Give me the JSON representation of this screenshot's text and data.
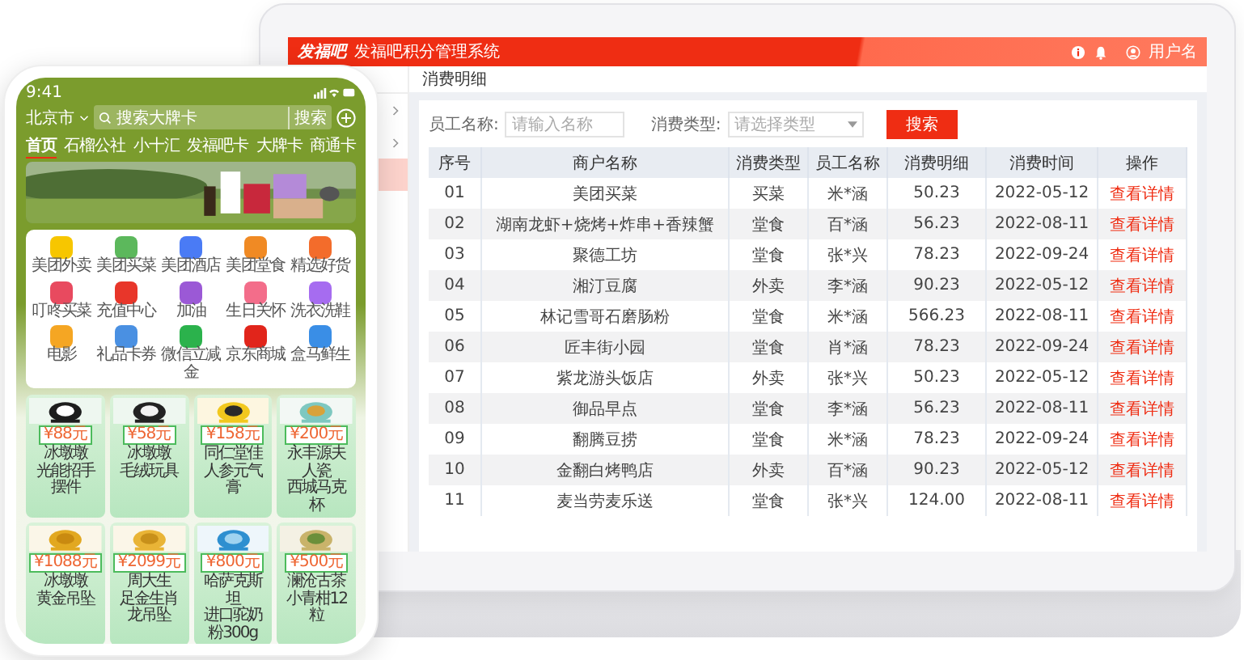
{
  "laptop": {
    "header": {
      "logo": "发福吧",
      "title": "发福吧积分管理系统",
      "user": "用户名"
    },
    "sidebar": {
      "items": [
        {
          "kind": "group",
          "selected": false
        },
        {
          "kind": "group",
          "selected": false
        },
        {
          "kind": "link",
          "selected": true
        }
      ]
    },
    "breadcrumb": "消费明细",
    "filters": [
      {
        "kind": "input",
        "label": "员工名称:",
        "placeholder": "请输入名称"
      },
      {
        "kind": "select",
        "label": "消费类型:",
        "placeholder": "请选择类型"
      }
    ],
    "search_button": "搜索",
    "table": {
      "columns": [
        {
          "label": "序号",
          "kind": "text"
        },
        {
          "label": "商户名称",
          "kind": "text"
        },
        {
          "label": "消费类型",
          "kind": "text"
        },
        {
          "label": "员工名称",
          "kind": "text"
        },
        {
          "label": "消费明细",
          "kind": "text"
        },
        {
          "label": "消费时间",
          "kind": "text"
        },
        {
          "label": "操作",
          "kind": "link"
        }
      ],
      "rows": [
        [
          "01",
          "美团买菜",
          "买菜",
          "米*涵",
          "50.23",
          "2022-05-12",
          "查看详情"
        ],
        [
          "02",
          "湖南龙虾+烧烤+炸串+香辣蟹",
          "堂食",
          "百*涵",
          "56.23",
          "2022-08-11",
          "查看详情"
        ],
        [
          "03",
          "聚德工坊",
          "堂食",
          "张*兴",
          "78.23",
          "2022-09-24",
          "查看详情"
        ],
        [
          "04",
          "湘汀豆腐",
          "外卖",
          "李*涵",
          "90.23",
          "2022-05-12",
          "查看详情"
        ],
        [
          "05",
          "林记雪哥石磨肠粉",
          "堂食",
          "米*涵",
          "566.23",
          "2022-08-11",
          "查看详情"
        ],
        [
          "06",
          "匠丰街小园",
          "堂食",
          "肖*涵",
          "78.23",
          "2022-09-24",
          "查看详情"
        ],
        [
          "07",
          "紫龙游头饭店",
          "外卖",
          "张*兴",
          "50.23",
          "2022-05-12",
          "查看详情"
        ],
        [
          "08",
          "御品早点",
          "堂食",
          "李*涵",
          "56.23",
          "2022-08-11",
          "查看详情"
        ],
        [
          "09",
          "翻腾豆捞",
          "堂食",
          "米*涵",
          "78.23",
          "2022-09-24",
          "查看详情"
        ],
        [
          "10",
          "金翻白烤鸭店",
          "外卖",
          "百*涵",
          "90.23",
          "2022-05-12",
          "查看详情"
        ],
        [
          "11",
          "麦当劳麦乐送",
          "堂食",
          "张*兴",
          "124.00",
          "2022-08-11",
          "查看详情"
        ]
      ]
    }
  },
  "phone": {
    "status_time": "9:41",
    "location": "北京市",
    "search_placeholder": "搜索大牌卡",
    "search_button": "搜索",
    "tabs": [
      {
        "label": "首页",
        "selected": true
      },
      {
        "label": "石榴公社",
        "selected": false
      },
      {
        "label": "小十汇",
        "selected": false
      },
      {
        "label": "发福吧卡",
        "selected": false
      },
      {
        "label": "大牌卡",
        "selected": false
      },
      {
        "label": "商通卡",
        "selected": false
      }
    ],
    "services": [
      {
        "label": "美团外卖",
        "color": "#f7c600"
      },
      {
        "label": "美团买菜",
        "color": "#5cb85c"
      },
      {
        "label": "美团酒店",
        "color": "#4a7bf5"
      },
      {
        "label": "美团堂食",
        "color": "#f08a24"
      },
      {
        "label": "精选好货",
        "color": "#f36c2b"
      },
      {
        "label": "叮咚买菜",
        "color": "#e84a5f"
      },
      {
        "label": "充值中心",
        "color": "#e8362a"
      },
      {
        "label": "加油",
        "color": "#9b59d6"
      },
      {
        "label": "生日关怀",
        "color": "#f36d8a"
      },
      {
        "label": "洗衣洗鞋",
        "color": "#a66cf0"
      },
      {
        "label": "电影",
        "color": "#f5a623"
      },
      {
        "label": "礼品卡券",
        "color": "#4a90e2"
      },
      {
        "label": "微信立减金",
        "color": "#2bb24c"
      },
      {
        "label": "京东商城",
        "color": "#e1251b"
      },
      {
        "label": "盒马鲜生",
        "color": "#3a8ee6"
      }
    ],
    "products": [
      {
        "price": "¥88元",
        "lines": [
          "冰墩墩",
          "光能招手摆件"
        ]
      },
      {
        "price": "¥58元",
        "lines": [
          "冰墩墩",
          "毛绒玩具"
        ]
      },
      {
        "price": "¥158元",
        "lines": [
          "同仁堂佳",
          "人参元气膏"
        ]
      },
      {
        "price": "¥200元",
        "lines": [
          "永丰源夫人瓷",
          "西城马克杯"
        ]
      },
      {
        "price": "¥1088元",
        "lines": [
          "冰墩墩",
          "黄金吊坠"
        ]
      },
      {
        "price": "¥2099元",
        "lines": [
          "周大生",
          "足金生肖龙吊坠"
        ]
      },
      {
        "price": "¥800元",
        "lines": [
          "哈萨克斯坦",
          "进口驼奶粉300g"
        ]
      },
      {
        "price": "¥500元",
        "lines": [
          "澜沧古茶",
          "小青柑12粒"
        ]
      }
    ]
  }
}
